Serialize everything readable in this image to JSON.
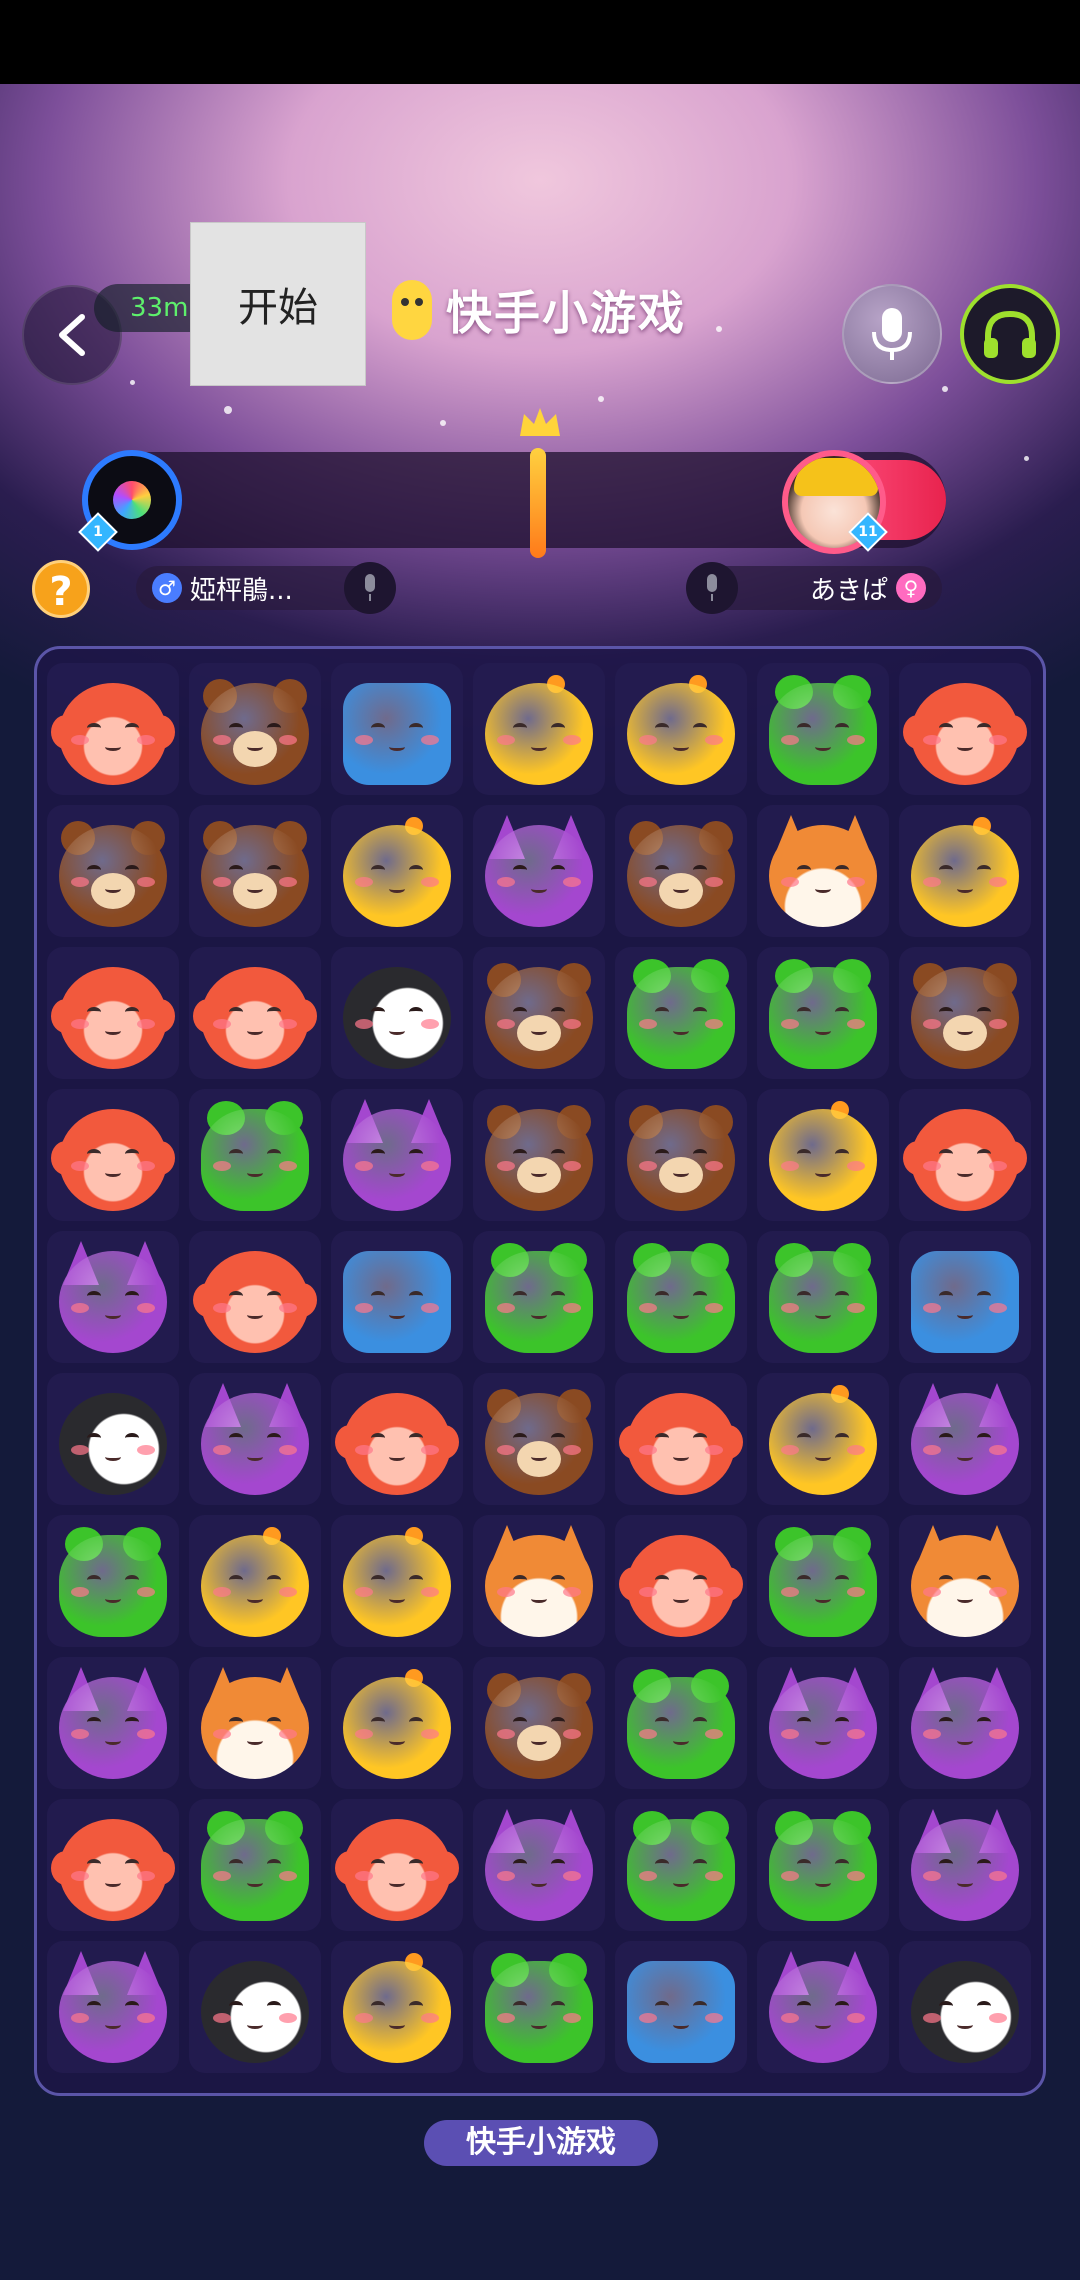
{
  "header": {
    "timer": "33m",
    "start_label": "开始",
    "app_title": "快手小游戏"
  },
  "players": {
    "left": {
      "name": "婭枰鵑...",
      "gender": "male",
      "level": "1"
    },
    "right": {
      "name": "あきぱ",
      "gender": "female",
      "level": "11"
    }
  },
  "help_label": "?",
  "footer_label": "快手小游戏",
  "colors": {
    "monkey": "#f2593d",
    "bear": "#8a4a22",
    "elephant": "#3b8fe0",
    "chick": "#ffc624",
    "frog": "#3cc42a",
    "cat": "#a447cf",
    "fox": "#f08a36",
    "penguin": "#2a2a2e"
  },
  "board": {
    "rows": [
      [
        "monkey",
        "bear",
        "elephant",
        "chick",
        "chick",
        "frog",
        "monkey"
      ],
      [
        "bear",
        "bear",
        "chick",
        "cat",
        "bear",
        "fox",
        "chick"
      ],
      [
        "monkey",
        "monkey",
        "penguin",
        "bear",
        "frog",
        "frog",
        "bear"
      ],
      [
        "monkey",
        "frog",
        "cat",
        "bear",
        "bear",
        "chick",
        "monkey"
      ],
      [
        "cat",
        "monkey",
        "elephant",
        "frog",
        "frog",
        "frog",
        "elephant"
      ],
      [
        "penguin",
        "cat",
        "monkey",
        "bear",
        "monkey",
        "chick",
        "cat"
      ],
      [
        "frog",
        "chick",
        "chick",
        "fox",
        "monkey",
        "frog",
        "fox"
      ],
      [
        "cat",
        "fox",
        "chick",
        "bear",
        "frog",
        "cat",
        "cat"
      ],
      [
        "monkey",
        "frog",
        "monkey",
        "cat",
        "frog",
        "frog",
        "cat"
      ],
      [
        "cat",
        "penguin",
        "chick",
        "frog",
        "elephant",
        "cat",
        "penguin"
      ]
    ]
  }
}
